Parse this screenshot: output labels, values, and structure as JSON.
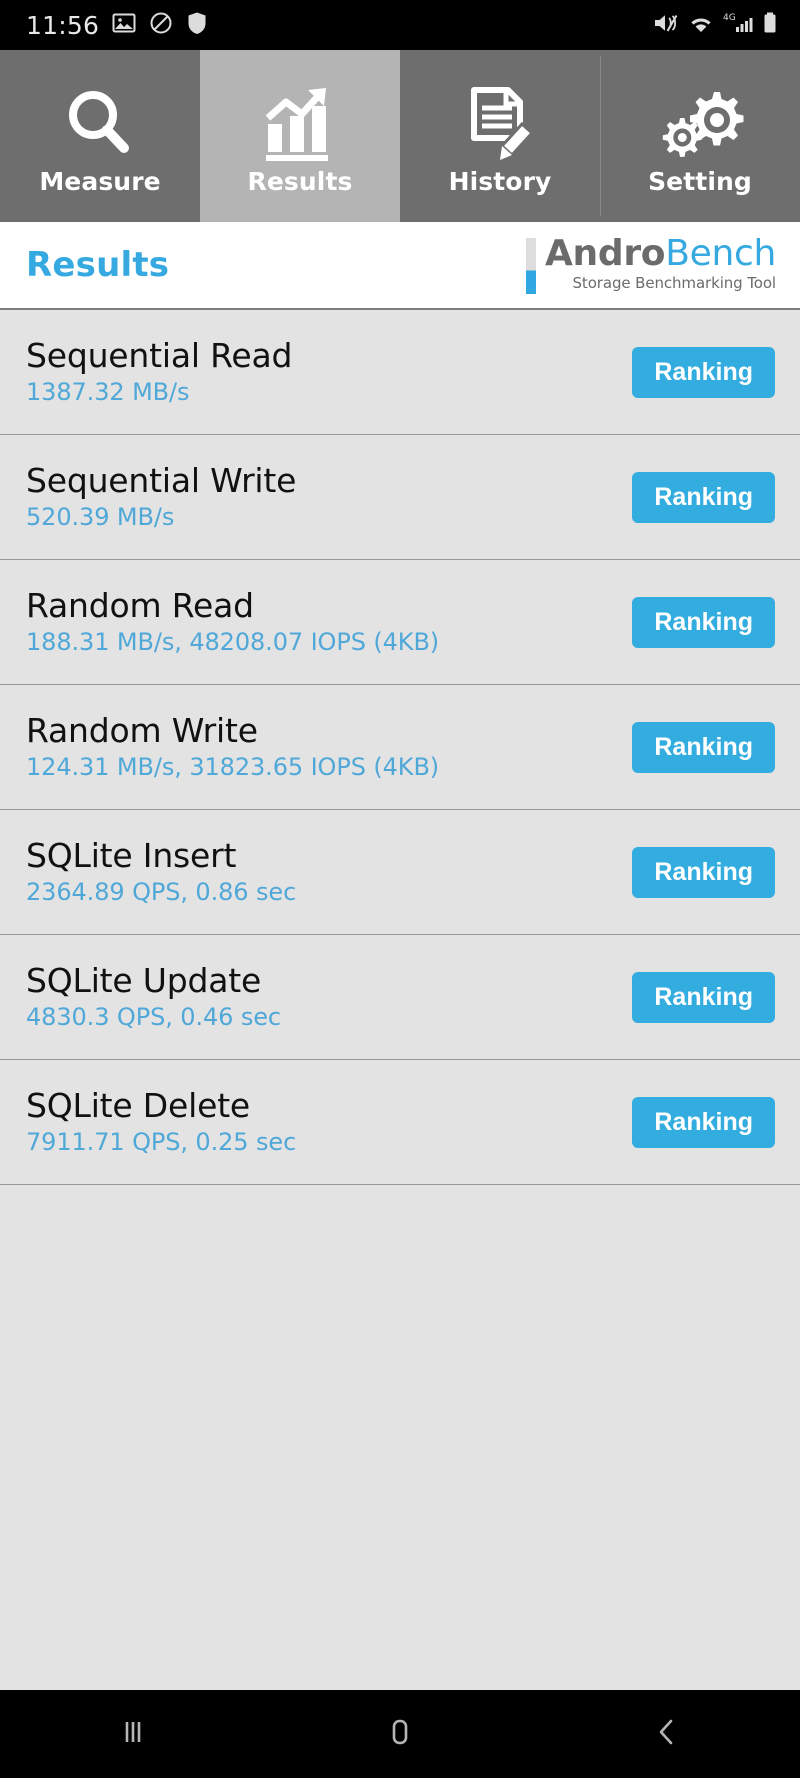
{
  "statusbar": {
    "time": "11:56",
    "left_icons": [
      "image-icon",
      "no-sim-icon",
      "shield-icon"
    ],
    "right_icons": [
      "mute-icon",
      "wifi-icon",
      "signal-4g-icon",
      "battery-icon"
    ],
    "network": "4G"
  },
  "tabs": [
    {
      "label": "Measure",
      "icon": "magnifier-icon",
      "active": false
    },
    {
      "label": "Results",
      "icon": "bar-chart-icon",
      "active": true
    },
    {
      "label": "History",
      "icon": "document-edit-icon",
      "active": false
    },
    {
      "label": "Setting",
      "icon": "gears-icon",
      "active": false
    }
  ],
  "header": {
    "title": "Results",
    "logo_primary": "Andro",
    "logo_secondary": "Bench",
    "logo_tagline": "Storage Benchmarking Tool"
  },
  "results": [
    {
      "name": "Sequential Read",
      "value": "1387.32 MB/s",
      "button": "Ranking"
    },
    {
      "name": "Sequential Write",
      "value": "520.39 MB/s",
      "button": "Ranking"
    },
    {
      "name": "Random Read",
      "value": "188.31 MB/s, 48208.07 IOPS (4KB)",
      "button": "Ranking"
    },
    {
      "name": "Random Write",
      "value": "124.31 MB/s, 31823.65 IOPS (4KB)",
      "button": "Ranking"
    },
    {
      "name": "SQLite Insert",
      "value": "2364.89 QPS, 0.86 sec",
      "button": "Ranking"
    },
    {
      "name": "SQLite Update",
      "value": "4830.3 QPS, 0.46 sec",
      "button": "Ranking"
    },
    {
      "name": "SQLite Delete",
      "value": "7911.71 QPS, 0.25 sec",
      "button": "Ranking"
    }
  ],
  "navbar": {
    "recents": "recents-icon",
    "home": "home-icon",
    "back": "back-icon"
  },
  "colors": {
    "accent_blue": "#33ace0",
    "value_blue": "#4fa8d8",
    "tab_inactive": "#6e6e6e",
    "tab_active": "#b4b4b4",
    "list_bg": "#e3e3e3"
  }
}
